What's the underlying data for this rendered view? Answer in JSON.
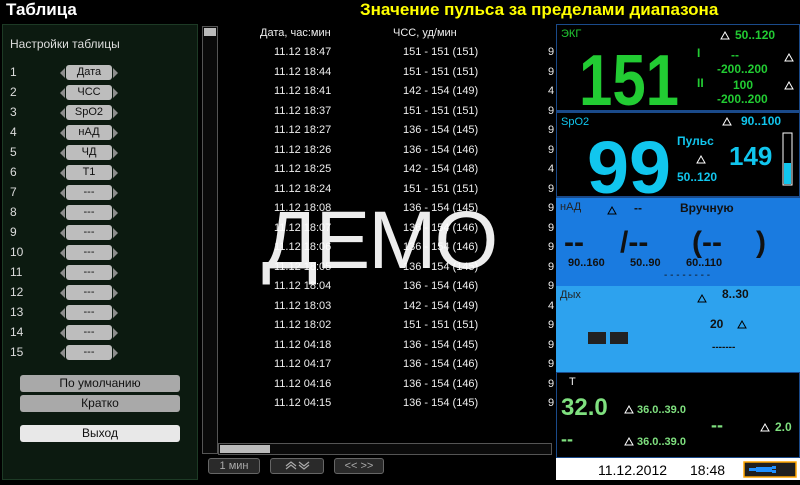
{
  "header": {
    "title": "Таблица",
    "alarm": "Значение пульса за пределами диапазона"
  },
  "settings": {
    "title": "Настройки таблицы",
    "rows": [
      {
        "n": "1",
        "label": "Дата"
      },
      {
        "n": "2",
        "label": "ЧСС"
      },
      {
        "n": "3",
        "label": "SpO2"
      },
      {
        "n": "4",
        "label": "нАД"
      },
      {
        "n": "5",
        "label": "ЧД"
      },
      {
        "n": "6",
        "label": "T1"
      },
      {
        "n": "7",
        "label": "---"
      },
      {
        "n": "8",
        "label": "---"
      },
      {
        "n": "9",
        "label": "---"
      },
      {
        "n": "10",
        "label": "---"
      },
      {
        "n": "11",
        "label": "---"
      },
      {
        "n": "12",
        "label": "---"
      },
      {
        "n": "13",
        "label": "---"
      },
      {
        "n": "14",
        "label": "---"
      },
      {
        "n": "15",
        "label": "---"
      }
    ],
    "default_btn": "По умолчанию",
    "brief_btn": "Кратко",
    "exit_btn": "Выход"
  },
  "table": {
    "col_date": "Дата, час:мин",
    "col_hr": "ЧСС, уд/мин",
    "rows": [
      {
        "date": "11.12 18:47",
        "hr": "151 - 151 (151)",
        "next": "9"
      },
      {
        "date": "11.12 18:44",
        "hr": "151 - 151 (151)",
        "next": "9"
      },
      {
        "date": "11.12 18:41",
        "hr": "142 - 154 (149)",
        "next": "4"
      },
      {
        "date": "11.12 18:37",
        "hr": "151 - 151 (151)",
        "next": "9"
      },
      {
        "date": "11.12 18:27",
        "hr": "136 - 154 (145)",
        "next": "9"
      },
      {
        "date": "11.12 18:26",
        "hr": "136 - 154 (146)",
        "next": "9"
      },
      {
        "date": "11.12 18:25",
        "hr": "142 - 154 (148)",
        "next": "4"
      },
      {
        "date": "11.12 18:24",
        "hr": "151 - 151 (151)",
        "next": "9"
      },
      {
        "date": "11.12 18:08",
        "hr": "136 - 154 (145)",
        "next": "9"
      },
      {
        "date": "11.12 18:07",
        "hr": "136 - 154 (146)",
        "next": "9"
      },
      {
        "date": "11.12 18:06",
        "hr": "136 - 154 (146)",
        "next": "9"
      },
      {
        "date": "11.12 18:05",
        "hr": "136 - 154 (145)",
        "next": "9"
      },
      {
        "date": "11.12 18:04",
        "hr": "136 - 154 (146)",
        "next": "9"
      },
      {
        "date": "11.12 18:03",
        "hr": "142 - 154 (149)",
        "next": "4"
      },
      {
        "date": "11.12 18:02",
        "hr": "151 - 151 (151)",
        "next": "9"
      },
      {
        "date": "11.12 04:18",
        "hr": "136 - 154 (145)",
        "next": "9"
      },
      {
        "date": "11.12 04:17",
        "hr": "136 - 154 (146)",
        "next": "9"
      },
      {
        "date": "11.12 04:16",
        "hr": "136 - 154 (146)",
        "next": "9"
      },
      {
        "date": "11.12 04:15",
        "hr": "136 - 154 (145)",
        "next": "9"
      }
    ],
    "watermark": "ДЕМО",
    "nav_interval": "1 мин",
    "nav_page": "<< >>"
  },
  "monitor": {
    "ecg": {
      "label": "ЭКГ",
      "value": "151",
      "limits": "50..120",
      "lead1": "I",
      "lead2": "II",
      "v1": "--",
      "r1": "-200..200",
      "v2": "100",
      "r2": "-200..200"
    },
    "spo2": {
      "label": "SpO2",
      "value": "99",
      "limits": "90..100",
      "pulse_label": "Пульс",
      "pulse_value": "149",
      "pulse_limits": "50..120"
    },
    "nad": {
      "label": "нАД",
      "mode_sym": "--",
      "mode": "Вручную",
      "sys": "--",
      "slash": "/--",
      "mean": "(--",
      "close": ")",
      "lim1": "90..160",
      "lim2": "50..90",
      "lim3": "60..110",
      "dashes": "- - - - - - - -"
    },
    "dyh": {
      "label": "Дых",
      "limits": "8..30",
      "apnea": "20",
      "dashes": "-------"
    },
    "temp": {
      "label": "T",
      "t1": "32.0",
      "lim1": "36.0..39.0",
      "t2": "--",
      "lim2": "36.0..39.0",
      "dt_v": "--",
      "dt_lim": "2.0"
    },
    "status": {
      "date": "11.12.2012",
      "time": "18:48"
    }
  },
  "colors": {
    "green": "#22cc33",
    "cyan": "#11c6ee",
    "yellow": "#ffff00",
    "nad_bg": "#1a7be0",
    "dyh_bg": "#2da2ee",
    "temp_green": "#7fe07f"
  }
}
